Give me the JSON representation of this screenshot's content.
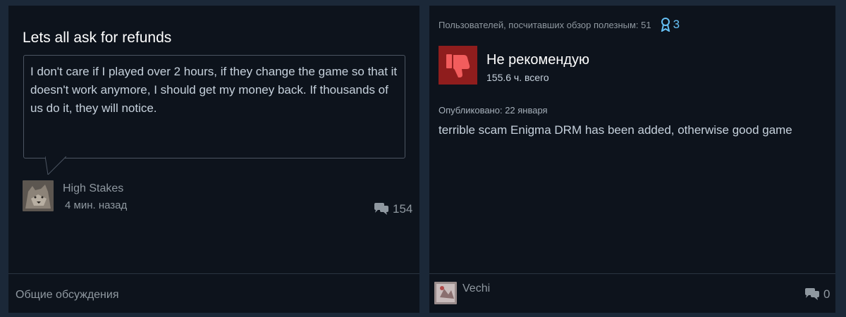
{
  "discussion": {
    "title": "Lets all ask for refunds",
    "body": "I don't care if I played over 2 hours, if they change the game so that it doesn't work anymore, I should get my money back. If thousands of us do it, they will notice.",
    "author": "High Stakes",
    "time_ago": "4 мин. назад",
    "comment_count": "154",
    "forum_label": "Общие обсуждения"
  },
  "review": {
    "helpful_label": "Пользователей, посчитавших обзор полезным: 51",
    "award_count": "3",
    "verdict": "Не рекомендую",
    "hours": "155.6 ч. всего",
    "published": "Опубликовано: 22 января",
    "text": "terrible scam Enigma DRM has been added, otherwise good game",
    "author": "Vechi",
    "comment_count": "0"
  },
  "icons": {
    "comments": "speech-bubbles-icon",
    "award": "award-ribbon-icon",
    "verdict": "thumbs-down-icon"
  },
  "colors": {
    "background": "#1b2838",
    "card": "#0d131c",
    "accent": "#66c0f4",
    "negative": "#8f1d1d"
  }
}
